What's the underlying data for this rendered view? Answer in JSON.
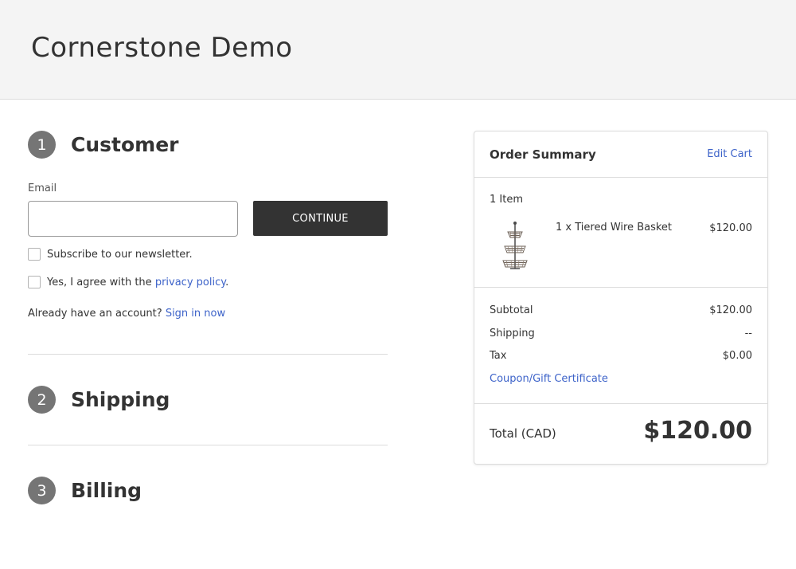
{
  "header": {
    "store_title": "Cornerstone Demo"
  },
  "steps": [
    {
      "number": "1",
      "title": "Customer"
    },
    {
      "number": "2",
      "title": "Shipping"
    },
    {
      "number": "3",
      "title": "Billing"
    }
  ],
  "customer": {
    "email_label": "Email",
    "email_value": "",
    "continue_label": "CONTINUE",
    "newsletter_label": "Subscribe to our newsletter.",
    "newsletter_checked": false,
    "privacy_prefix": "Yes, I agree with the ",
    "privacy_link": "privacy policy",
    "privacy_suffix": ".",
    "privacy_checked": false,
    "account_prompt": "Already have an account?",
    "signin_link": "Sign in now"
  },
  "summary": {
    "title": "Order Summary",
    "edit_cart": "Edit Cart",
    "item_count": "1 Item",
    "items": [
      {
        "name": "1 x Tiered Wire Basket",
        "price": "$120.00",
        "icon": "tiered-wire-basket-thumbnail"
      }
    ],
    "subtotal_label": "Subtotal",
    "subtotal_value": "$120.00",
    "shipping_label": "Shipping",
    "shipping_value": "--",
    "tax_label": "Tax",
    "tax_value": "$0.00",
    "coupon_link": "Coupon/Gift Certificate",
    "total_label": "Total (CAD)",
    "total_value": "$120.00"
  },
  "colors": {
    "accent_link": "#3d63c9",
    "button_dark": "#333333",
    "step_badge": "#757575",
    "header_bg": "#f4f4f4"
  }
}
